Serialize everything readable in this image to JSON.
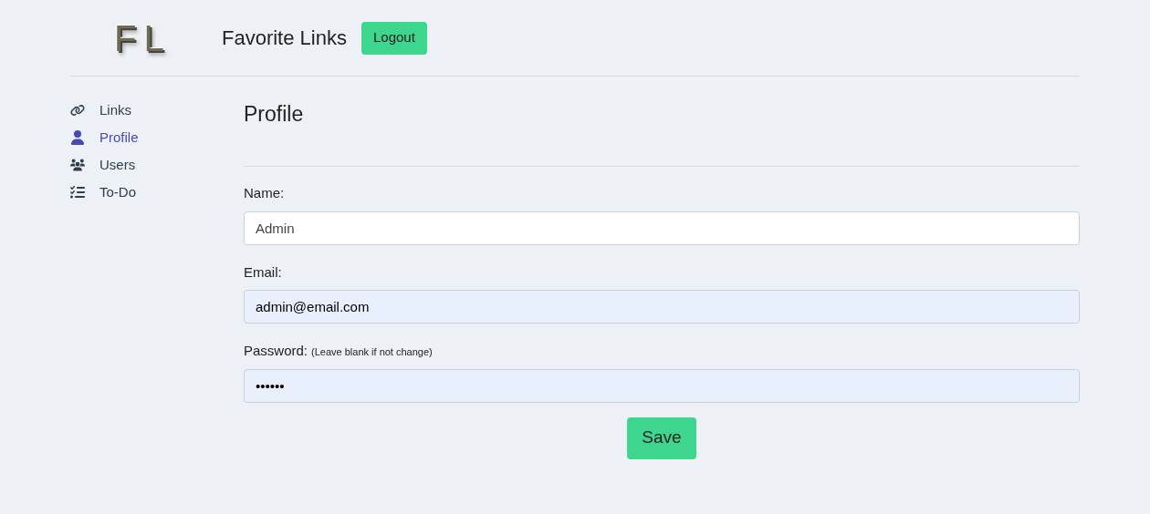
{
  "header": {
    "logo": "FL",
    "title": "Favorite Links",
    "logout": "Logout"
  },
  "sidebar": {
    "items": [
      {
        "label": "Links",
        "kind": "link",
        "selected": false
      },
      {
        "label": "Profile",
        "kind": "user",
        "selected": true
      },
      {
        "label": "Users",
        "kind": "users",
        "selected": false
      },
      {
        "label": "To-Do",
        "kind": "todo",
        "selected": false
      }
    ]
  },
  "page": {
    "title": "Profile",
    "fields": [
      {
        "label": "Name:",
        "value": "Admin",
        "autofilled": false
      },
      {
        "label": "Email:",
        "value": "admin@email.com",
        "autofilled": true
      },
      {
        "label": "Password:",
        "hint": "(Leave blank if not change)",
        "value": "••••••",
        "autofilled": true
      }
    ],
    "save": "Save"
  }
}
